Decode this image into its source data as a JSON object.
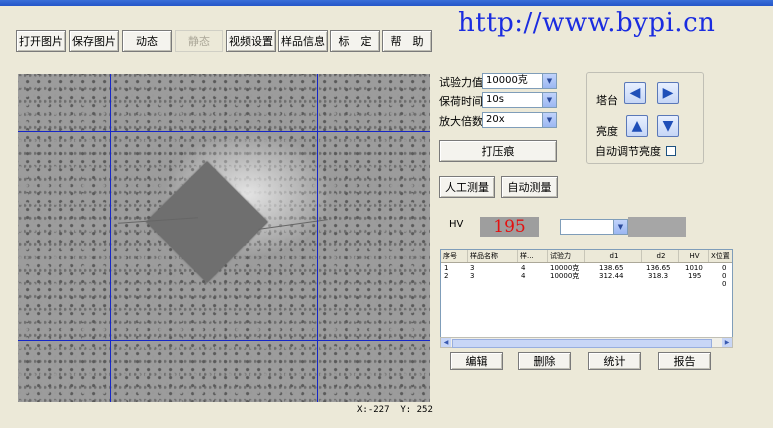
{
  "toolbar": {
    "buttons": [
      "打开图片",
      "保存图片",
      "动态",
      "静态",
      "视频设置",
      "样品信息",
      "标　定",
      "帮　助"
    ]
  },
  "watermark_url": "http://www.bypi.cn",
  "viewer": {
    "coord_x_label": "X:",
    "coord_x": "-227",
    "coord_y_label": "Y:",
    "coord_y": "252"
  },
  "settings": {
    "force_label": "试验力值",
    "force_value": "10000克",
    "hold_label": "保荷时间",
    "hold_value": "10s",
    "magnify_label": "放大倍数",
    "magnify_value": "20x",
    "indent_button": "打压痕",
    "manual_button": "人工测量",
    "auto_button": "自动测量"
  },
  "stage_panel": {
    "stage_label": "塔台",
    "brightness_label": "亮度",
    "auto_brightness_label": "自动调节亮度"
  },
  "hv": {
    "label": "HV",
    "value": "195",
    "select_value": ""
  },
  "table": {
    "columns": [
      "序号",
      "样品名称",
      "样...",
      "试验力",
      "d1",
      "d2",
      "HV",
      "X位置"
    ],
    "rows": [
      [
        "1",
        "3",
        "4",
        "10000克",
        "138.65",
        "136.65",
        "1010",
        "0"
      ],
      [
        "2",
        "3",
        "4",
        "10000克",
        "312.44",
        "318.3",
        "195",
        "0"
      ],
      [
        "",
        "",
        "",
        "",
        "",
        "",
        "",
        "0"
      ]
    ]
  },
  "actions": [
    "编辑",
    "删除",
    "统计",
    "报告"
  ],
  "colors": {
    "crosshair": "#1526c8",
    "hv_value": "#e41010",
    "watermark": "#1a2ce0"
  }
}
